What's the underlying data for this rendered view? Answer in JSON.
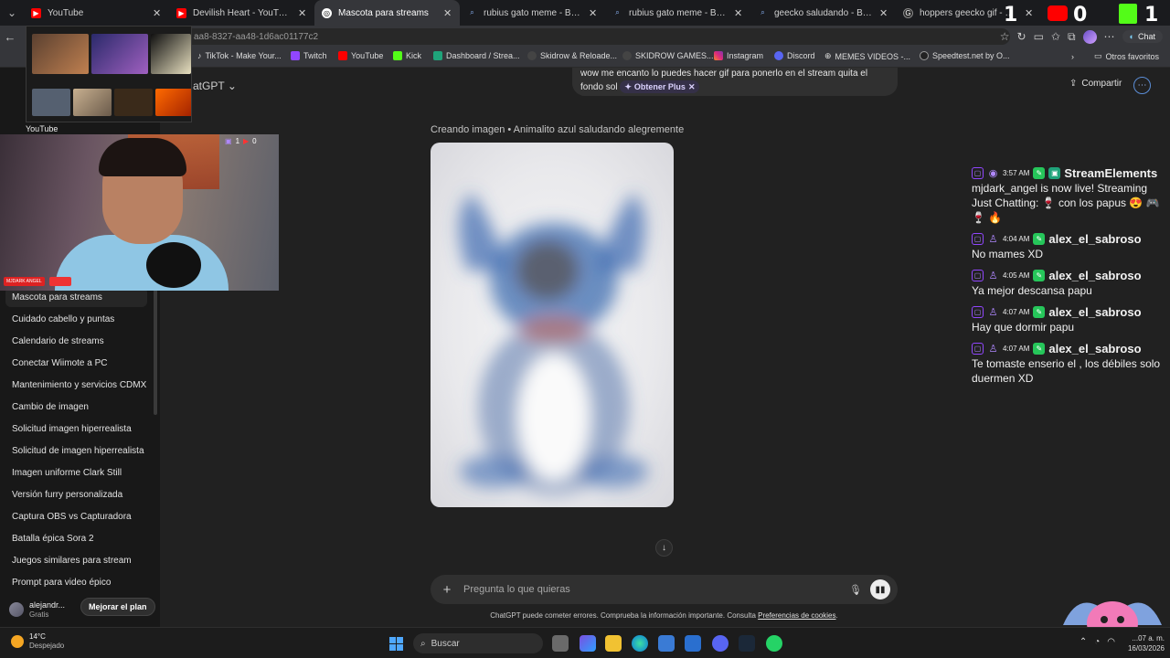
{
  "browser": {
    "tabs": [
      {
        "title": "YouTube",
        "icon": "youtube-icon",
        "active": false
      },
      {
        "title": "Devilish Heart - YouTube",
        "icon": "youtube-icon",
        "active": false
      },
      {
        "title": "Mascota para streams",
        "icon": "chatgpt-icon",
        "active": true
      },
      {
        "title": "rubius gato meme - Búsqueda",
        "icon": "search-icon",
        "active": false
      },
      {
        "title": "rubius gato meme - Búsqueda Im",
        "icon": "search-icon",
        "active": false
      },
      {
        "title": "geecko saludando - Búsqueda",
        "icon": "search-icon",
        "active": false
      },
      {
        "title": "hoppers geecko gif - Buscar co",
        "icon": "google-icon",
        "active": false
      }
    ],
    "url": "aa8-8327-aa48-1d6ac01177c2",
    "chat_button": "Chat",
    "bookmarks": [
      "TikTok - Make Your...",
      "Twitch",
      "YouTube",
      "Kick",
      "Dashboard / Strea...",
      "Skidrow & Reloade...",
      "SKIDROW GAMES...",
      "Instagram",
      "Discord",
      "MEMES VIDEOS -...",
      "Speedtest.net by O..."
    ],
    "bookmarks_other": "Otros favoritos"
  },
  "yt_preview": {
    "label": "YouTube"
  },
  "sidebar": {
    "items": [
      "Mascota para streams",
      "Cuidado cabello y puntas",
      "Calendario de streams",
      "Conectar Wiimote a PC",
      "Mantenimiento y servicios CDMX",
      "Cambio de imagen",
      "Solicitud imagen hiperrealista",
      "Solicitud de imagen hiperrealista",
      "Imagen uniforme Clark Still",
      "Versión furry personalizada",
      "Captura OBS vs Capturadora",
      "Batalla épica Sora 2",
      "Juegos similares para stream",
      "Prompt para video épico"
    ],
    "user": {
      "name": "alejandr...",
      "plan": "Gratis"
    },
    "upgrade": "Mejorar el plan"
  },
  "main": {
    "model_title": "atGPT",
    "share": "Compartir",
    "user_message": "wow me encanto lo puedes hacer gif para ponerlo en el stream quita el fondo sol",
    "plus_pill": "Obtener Plus",
    "creating": "Creando imagen • Animalito azul saludando alegremente",
    "composer_placeholder": "Pregunta lo que quieras",
    "disclaimer_text": "ChatGPT puede cometer errores. Comprueba la información importante. Consulta ",
    "disclaimer_link": "Preferencias de cookies",
    "disclaimer_end": "."
  },
  "overlay": {
    "counter_1": "1",
    "counter_0": "0",
    "counter_k": "1",
    "cam_counter_a": "1",
    "cam_counter_b": "0",
    "cam_badge": "MJDARK ANGEL"
  },
  "stream_chat": [
    {
      "time": "3:57 AM",
      "user": "StreamElements",
      "text": "mjdark_angel is now live! Streaming Just Chatting: 🍷 con los papus 😍 🎮 🍷 🔥"
    },
    {
      "time": "4:04 AM",
      "user": "alex_el_sabroso",
      "text": "No mames XD"
    },
    {
      "time": "4:05 AM",
      "user": "alex_el_sabroso",
      "text": "Ya mejor descansa papu"
    },
    {
      "time": "4:07 AM",
      "user": "alex_el_sabroso",
      "text": "Hay que dormir papu"
    },
    {
      "time": "4:07 AM",
      "user": "alex_el_sabroso",
      "text": "Te tomaste enserio el , los débiles solo duermen XD"
    }
  ],
  "taskbar": {
    "temp": "14°C",
    "condition": "Despejado",
    "search": "Buscar",
    "time": "...07 a. m.",
    "date": "16/03/2026"
  },
  "colors": {
    "accent": "#9146ff",
    "brand_green": "#26c65a",
    "youtube_red": "#ff0000",
    "background": "#212121",
    "sidebar": "#181818"
  }
}
